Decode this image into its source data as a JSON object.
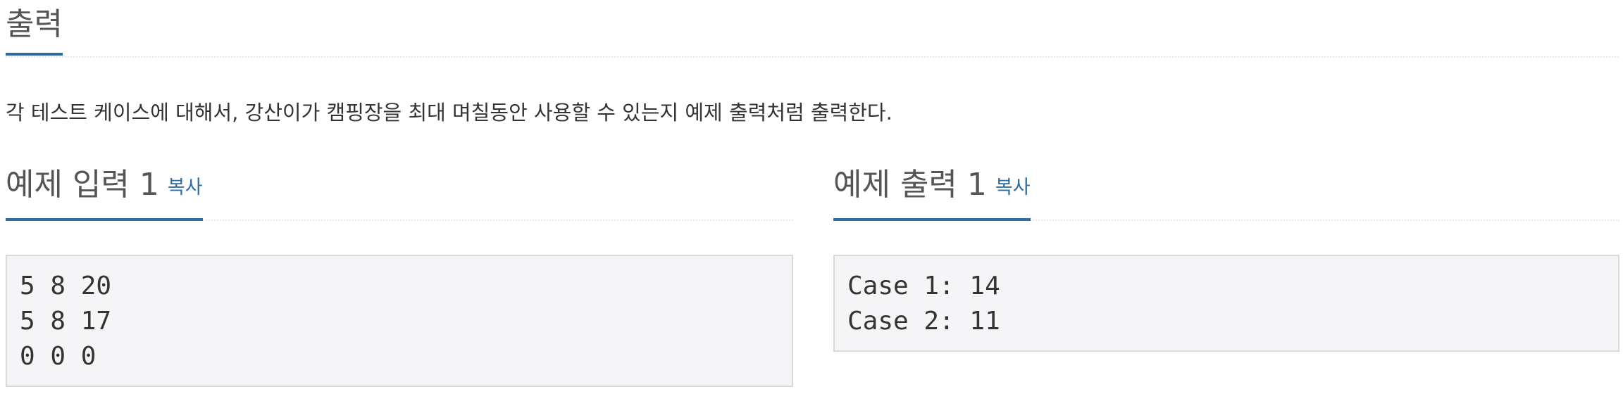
{
  "output_section": {
    "title": "출력",
    "description": "각 테스트 케이스에 대해서, 강산이가 캠핑장을 최대 며칠동안 사용할 수 있는지 예제 출력처럼 출력한다."
  },
  "sample_input": {
    "title": "예제 입력 1",
    "copy_label": "복사",
    "content": "5 8 20\n5 8 17\n0 0 0"
  },
  "sample_output": {
    "title": "예제 출력 1",
    "copy_label": "복사",
    "content": "Case 1: 14\nCase 2: 11"
  },
  "colors": {
    "accent": "#2e6da4",
    "heading": "#555555",
    "text": "#333333",
    "code_bg": "#f5f5f7",
    "code_border": "#d9d9d9"
  }
}
